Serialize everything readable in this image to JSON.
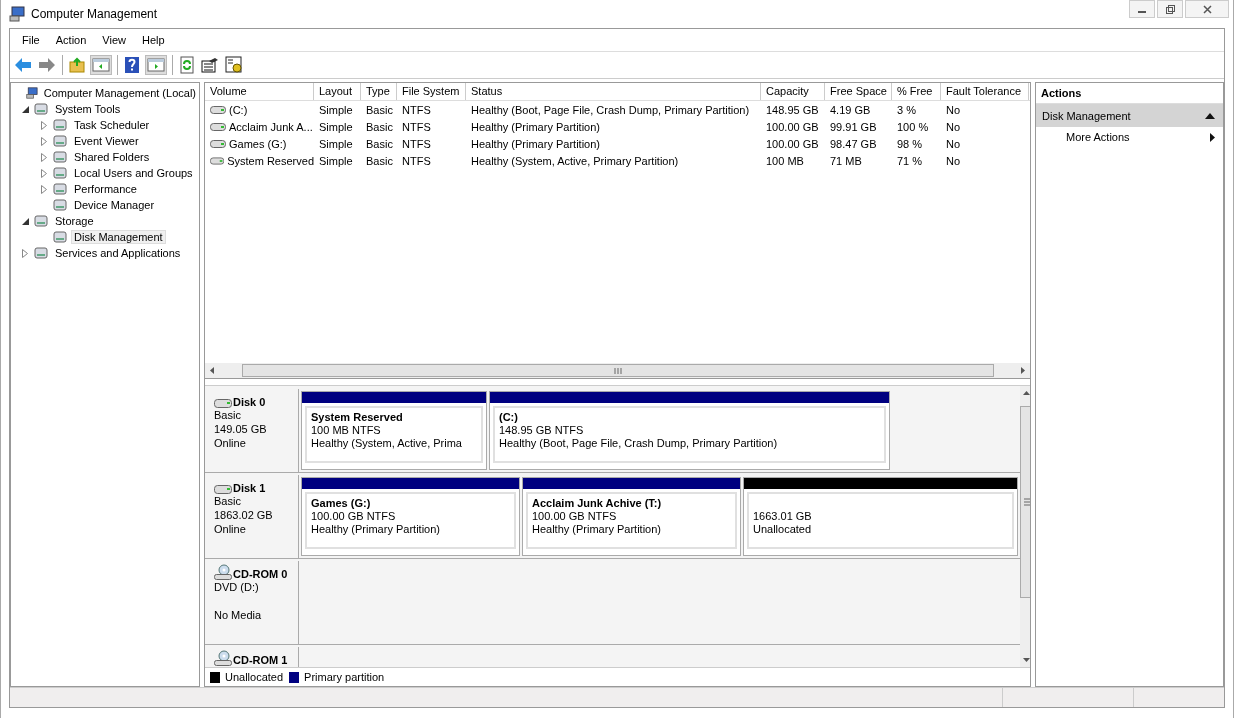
{
  "window": {
    "title": "Computer Management"
  },
  "menu": [
    "File",
    "Action",
    "View",
    "Help"
  ],
  "tree": [
    {
      "label": "Computer Management (Local)",
      "selected": false,
      "children": [
        {
          "label": "System Tools",
          "selected": false,
          "expanded": true,
          "children": [
            {
              "label": "Task Scheduler",
              "selected": false,
              "expanded": false
            },
            {
              "label": "Event Viewer",
              "selected": false,
              "expanded": false
            },
            {
              "label": "Shared Folders",
              "selected": false,
              "expanded": false
            },
            {
              "label": "Local Users and Groups",
              "selected": false,
              "expanded": false
            },
            {
              "label": "Performance",
              "selected": false,
              "expanded": false
            },
            {
              "label": "Device Manager",
              "selected": false
            }
          ]
        },
        {
          "label": "Storage",
          "selected": false,
          "expanded": true,
          "children": [
            {
              "label": "Disk Management",
              "selected": true
            }
          ]
        },
        {
          "label": "Services and Applications",
          "selected": false,
          "expanded": false
        }
      ]
    }
  ],
  "volume_table": {
    "columns": [
      "Volume",
      "Layout",
      "Type",
      "File System",
      "Status",
      "Capacity",
      "Free Space",
      "% Free",
      "Fault Tolerance"
    ],
    "rows": [
      [
        "(C:)",
        "Simple",
        "Basic",
        "NTFS",
        "Healthy (Boot, Page File, Crash Dump, Primary Partition)",
        "148.95 GB",
        "4.19 GB",
        "3 %",
        "No"
      ],
      [
        "Acclaim Junk A...",
        "Simple",
        "Basic",
        "NTFS",
        "Healthy (Primary Partition)",
        "100.00 GB",
        "99.91 GB",
        "100 %",
        "No"
      ],
      [
        "Games (G:)",
        "Simple",
        "Basic",
        "NTFS",
        "Healthy (Primary Partition)",
        "100.00 GB",
        "98.47 GB",
        "98 %",
        "No"
      ],
      [
        "System Reserved",
        "Simple",
        "Basic",
        "NTFS",
        "Healthy (System, Active, Primary Partition)",
        "100 MB",
        "71 MB",
        "71 %",
        "No"
      ]
    ]
  },
  "disks": [
    {
      "name": "Disk 0",
      "kind": "disk",
      "lines": [
        "Basic",
        "149.05 GB",
        "Online"
      ],
      "partitions": [
        {
          "kind": "primary",
          "name": "System Reserved",
          "size": "100 MB NTFS",
          "status": "Healthy (System, Active, Prima"
        },
        {
          "kind": "primary",
          "name": "(C:)",
          "size": "148.95 GB NTFS",
          "status": "Healthy (Boot, Page File, Crash Dump, Primary Partition)"
        }
      ]
    },
    {
      "name": "Disk 1",
      "kind": "disk",
      "lines": [
        "Basic",
        "1863.02 GB",
        "Online"
      ],
      "partitions": [
        {
          "kind": "primary",
          "name": "Games  (G:)",
          "size": "100.00 GB NTFS",
          "status": "Healthy (Primary Partition)"
        },
        {
          "kind": "primary",
          "name": "Acclaim Junk Achive  (T:)",
          "size": "100.00 GB NTFS",
          "status": "Healthy (Primary Partition)"
        },
        {
          "kind": "unallocated",
          "size": "1663.01 GB",
          "status": "Unallocated"
        }
      ]
    },
    {
      "name": "CD-ROM 0",
      "kind": "cdrom",
      "lines": [
        "DVD (D:)",
        "No Media"
      ]
    },
    {
      "name": "CD-ROM 1",
      "kind": "cdrom"
    }
  ],
  "legend": [
    {
      "label": "Unallocated",
      "color": "#000000"
    },
    {
      "label": "Primary partition",
      "color": "#000080"
    }
  ],
  "actions": {
    "title": "Actions",
    "section": {
      "label": "Disk Management",
      "expanded": true
    },
    "items": [
      "More Actions"
    ]
  }
}
